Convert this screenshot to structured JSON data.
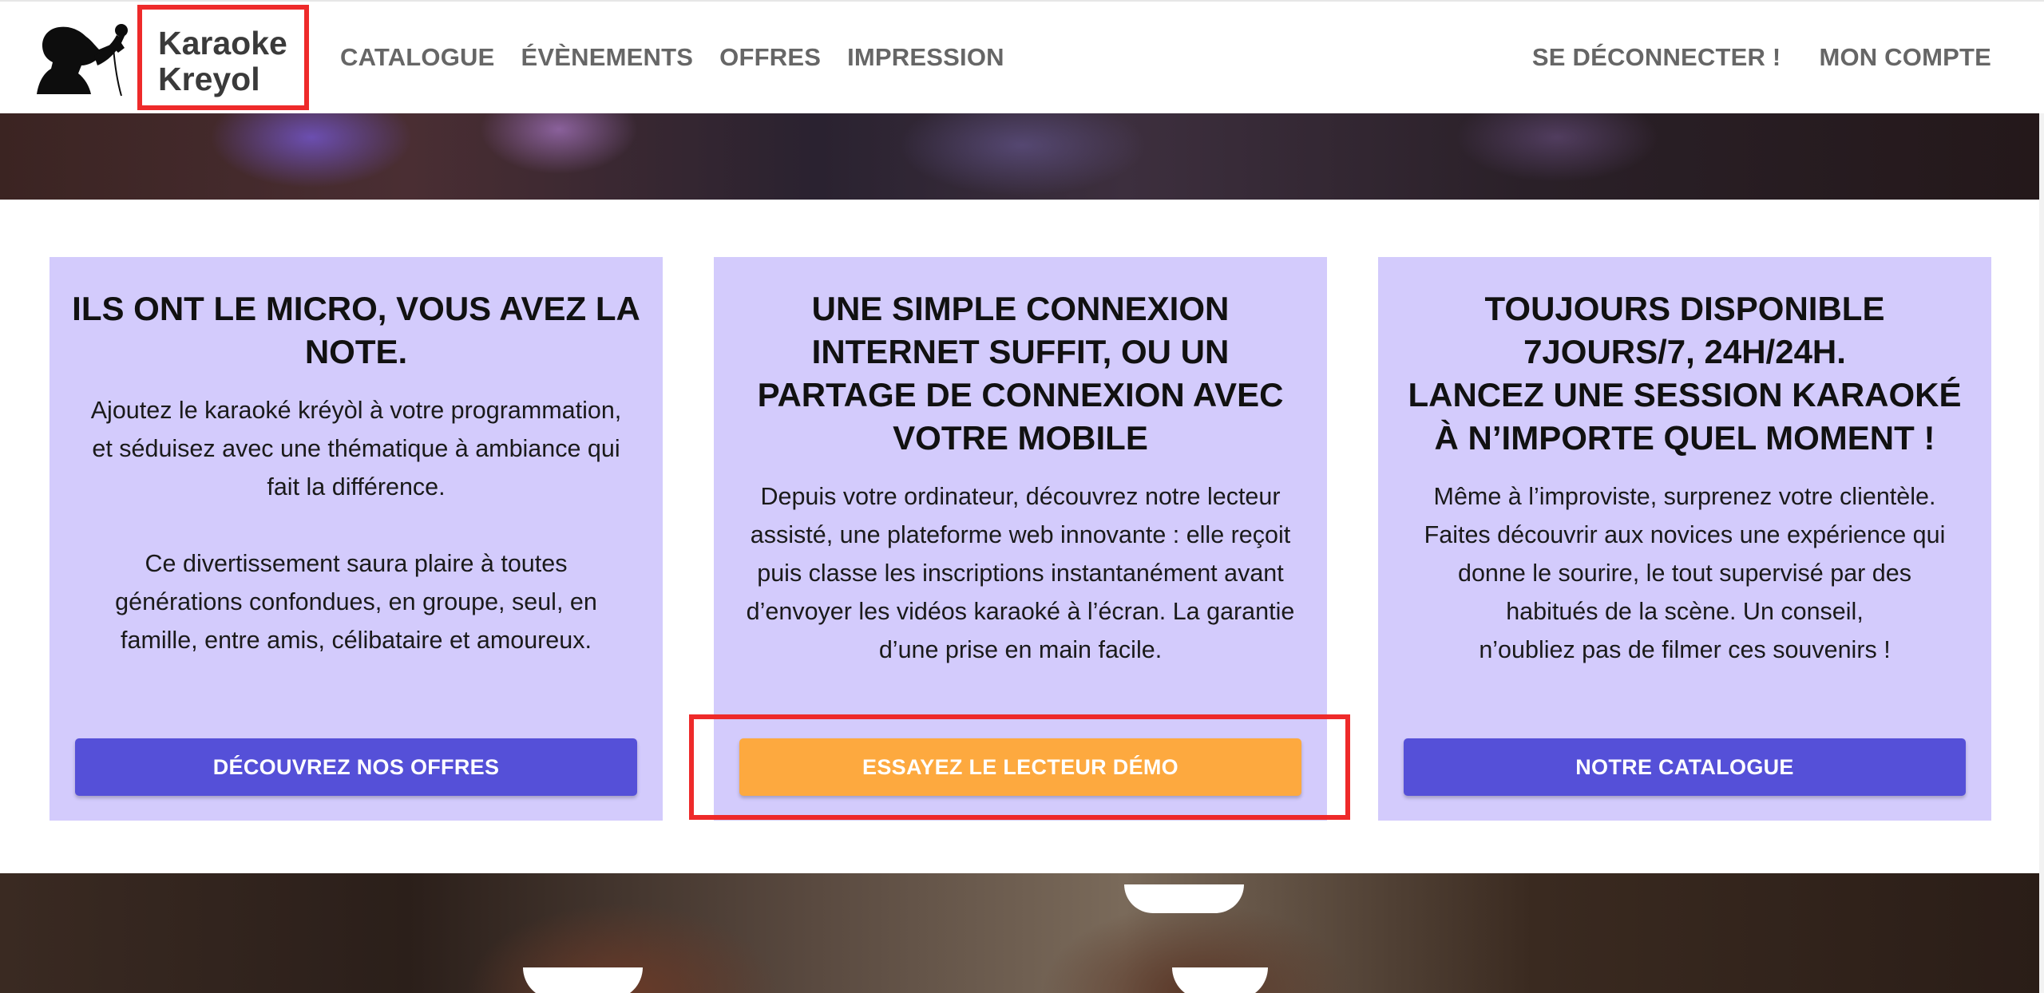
{
  "header": {
    "logo_text": "Karaoke\nKreyol",
    "nav_left": [
      {
        "label": "CATALOGUE"
      },
      {
        "label": "ÉVÈNEMENTS"
      },
      {
        "label": "OFFRES"
      },
      {
        "label": "IMPRESSION"
      }
    ],
    "nav_right": [
      {
        "label": "SE DÉCONNECTER !"
      },
      {
        "label": "MON COMPTE"
      }
    ]
  },
  "cards": [
    {
      "title": "ILS ONT LE MICRO, VOUS AVEZ LA NOTE.",
      "paragraphs": [
        "Ajoutez le karaoké kréyòl à votre programmation, et séduisez avec une thématique à ambiance qui fait la différence.",
        "Ce divertissement saura plaire à toutes générations confondues, en groupe, seul, en famille, entre amis, célibataire et amoureux."
      ],
      "button_label": "DÉCOUVREZ NOS OFFRES"
    },
    {
      "title": "UNE SIMPLE CONNEXION INTERNET SUFFIT, OU UN PARTAGE DE CONNEXION AVEC VOTRE MOBILE",
      "paragraphs": [
        "Depuis votre ordinateur, découvrez notre lecteur assisté, une plateforme web innovante : elle reçoit puis classe les inscriptions instantanément avant d’envoyer les vidéos karaoké à l’écran. La garantie d’une prise en main facile."
      ],
      "button_label": "ESSAYEZ LE LECTEUR DÉMO"
    },
    {
      "title_lines": [
        "TOUJOURS DISPONIBLE",
        "7JOURS/7, 24H/24H.",
        "LANCEZ UNE SESSION KARAOKÉ",
        "À N’IMPORTE QUEL MOMENT !"
      ],
      "paragraphs": [
        "Même à l’improviste, surprenez votre clientèle. Faites découvrir aux novices une expérience qui donne le sourire, le tout supervisé par des habitués de la scène. Un conseil,",
        "n’oubliez pas de filmer ces souvenirs !"
      ],
      "button_label": "NOTRE CATALOGUE"
    }
  ],
  "colors": {
    "card_bg": "#d3cbfc",
    "button_primary": "#5550d8",
    "button_demo": "#fda93f",
    "annotation_red": "#ee2a2a",
    "nav_text": "#666666"
  },
  "icons": {
    "logo": "singer-silhouette-icon"
  }
}
